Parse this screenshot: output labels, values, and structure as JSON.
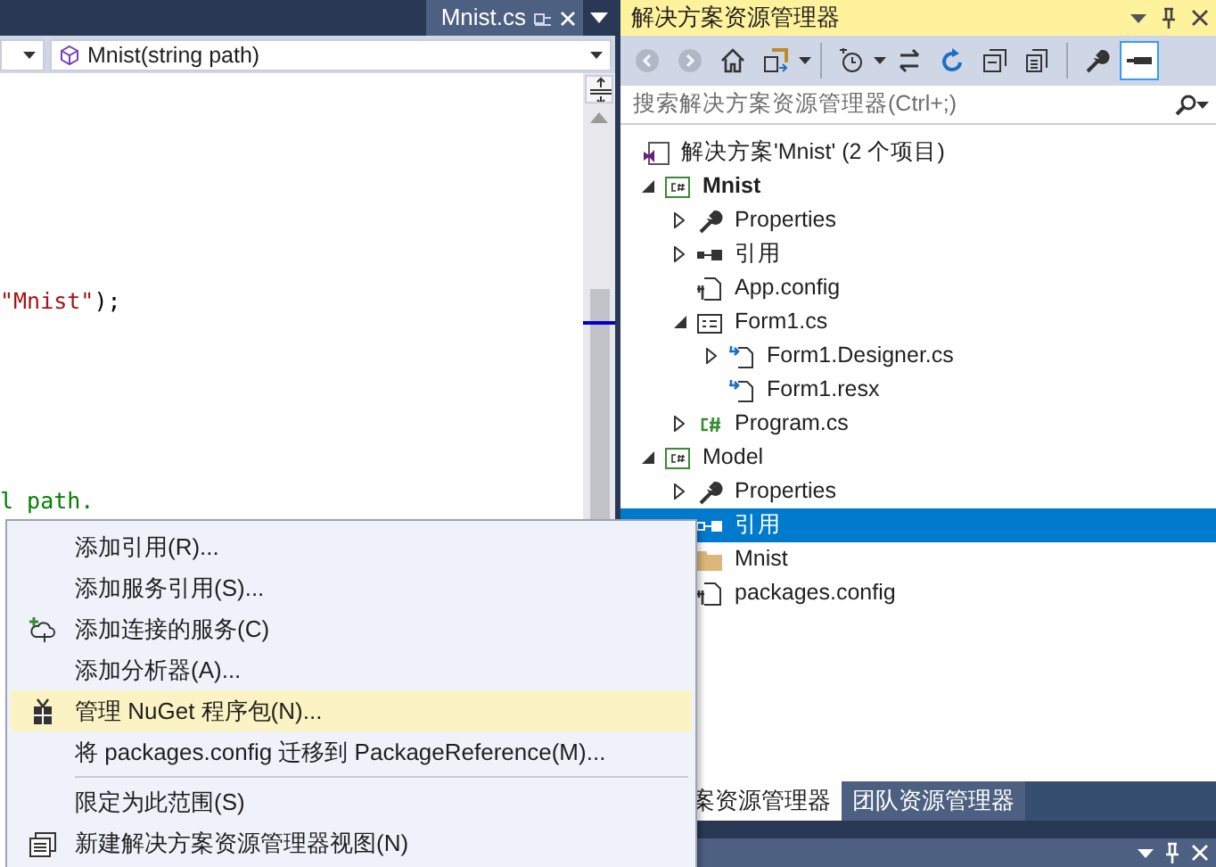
{
  "editor": {
    "tab": {
      "title": "Mnist.cs"
    },
    "member_dropdown": {
      "value": "Mnist(string path)"
    },
    "code_lines": [
      [
        {
          "text": "\"Mnist\"",
          "kind": "string"
        },
        {
          "text": ");",
          "kind": "plain"
        }
      ],
      [
        {
          "text": "l path.",
          "kind": "comment"
        }
      ]
    ]
  },
  "solution_explorer": {
    "title": "解决方案资源管理器",
    "toolbar": [
      {
        "kind": "back",
        "disabled": true,
        "on": false
      },
      {
        "kind": "forward",
        "disabled": true,
        "on": false
      },
      {
        "kind": "home",
        "disabled": false,
        "on": false
      },
      {
        "kind": "switch-views",
        "disabled": false,
        "on": false
      },
      {
        "kind": "pending-changes",
        "disabled": false,
        "on": false
      },
      {
        "kind": "sync",
        "disabled": false,
        "on": false
      },
      {
        "kind": "refresh",
        "disabled": false,
        "on": false
      },
      {
        "kind": "collapse",
        "disabled": false,
        "on": false
      },
      {
        "kind": "show-all",
        "disabled": false,
        "on": false
      },
      {
        "kind": "properties",
        "disabled": false,
        "on": false
      },
      {
        "kind": "preview",
        "disabled": false,
        "on": true
      }
    ],
    "search": {
      "placeholder": "搜索解决方案资源管理器(Ctrl+;)"
    },
    "tree": [
      {
        "label": "解决方案'Mnist' (2 个项目)",
        "kind": "solution",
        "selected": false,
        "children": [
          {
            "label": "Mnist",
            "kind": "csproj",
            "startup_project": true,
            "expanded": true,
            "selected": false,
            "children": [
              {
                "label": "Properties",
                "kind": "wrench",
                "expanded": false,
                "selected": false
              },
              {
                "label": "引用",
                "kind": "reference",
                "expanded": false,
                "selected": false
              },
              {
                "label": "App.config",
                "kind": "config",
                "selected": false
              },
              {
                "label": "Form1.cs",
                "kind": "form",
                "expanded": true,
                "selected": false,
                "children": [
                  {
                    "label": "Form1.Designer.cs",
                    "kind": "dependent",
                    "expanded": false,
                    "selected": false
                  },
                  {
                    "label": "Form1.resx",
                    "kind": "dependent",
                    "selected": false
                  }
                ]
              },
              {
                "label": "Program.cs",
                "kind": "csharp",
                "expanded": false,
                "selected": false
              }
            ]
          },
          {
            "label": "Model",
            "kind": "csproj",
            "startup_project": false,
            "expanded": true,
            "selected": false,
            "children": [
              {
                "label": "Properties",
                "kind": "wrench",
                "expanded": false,
                "selected": false
              },
              {
                "label": "引用",
                "kind": "reference",
                "selected": true
              },
              {
                "label": "Mnist",
                "kind": "folder",
                "selected": false
              },
              {
                "label": "packages.config",
                "kind": "config",
                "selected": false
              }
            ]
          }
        ]
      }
    ],
    "bottom_tabs": [
      {
        "label": "案资源管理器",
        "selected": true
      },
      {
        "label": "团队资源管理器",
        "selected": false
      }
    ]
  },
  "context_menu": [
    {
      "label": "添加引用(R)...",
      "kind": "plain",
      "highlighted": false
    },
    {
      "label": "添加服务引用(S)...",
      "kind": "plain",
      "highlighted": false
    },
    {
      "label": "添加连接的服务(C)",
      "kind": "connected-service",
      "highlighted": false
    },
    {
      "label": "添加分析器(A)...",
      "kind": "plain",
      "highlighted": false
    },
    {
      "label": "管理 NuGet 程序包(N)...",
      "kind": "package",
      "highlighted": true
    },
    {
      "label": "将 packages.config 迁移到 PackageReference(M)...",
      "kind": "plain",
      "highlighted": false
    },
    {
      "kind": "separator"
    },
    {
      "label": "限定为此范围(S)",
      "kind": "plain",
      "highlighted": false
    },
    {
      "label": "新建解决方案资源管理器视图(N)",
      "kind": "new-view",
      "highlighted": false
    }
  ]
}
